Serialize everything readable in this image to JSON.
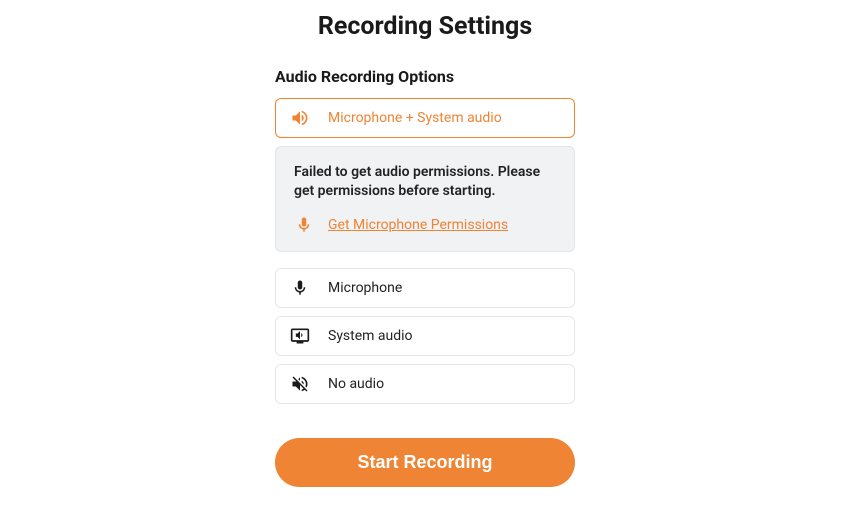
{
  "title": "Recording Settings",
  "section_title": "Audio Recording Options",
  "options": {
    "mic_system": "Microphone + System audio",
    "mic": "Microphone",
    "system": "System audio",
    "none": "No audio"
  },
  "permission": {
    "message": "Failed to get audio permissions. Please get permissions before starting.",
    "link": "Get Microphone Permissions"
  },
  "start_button": "Start Recording"
}
